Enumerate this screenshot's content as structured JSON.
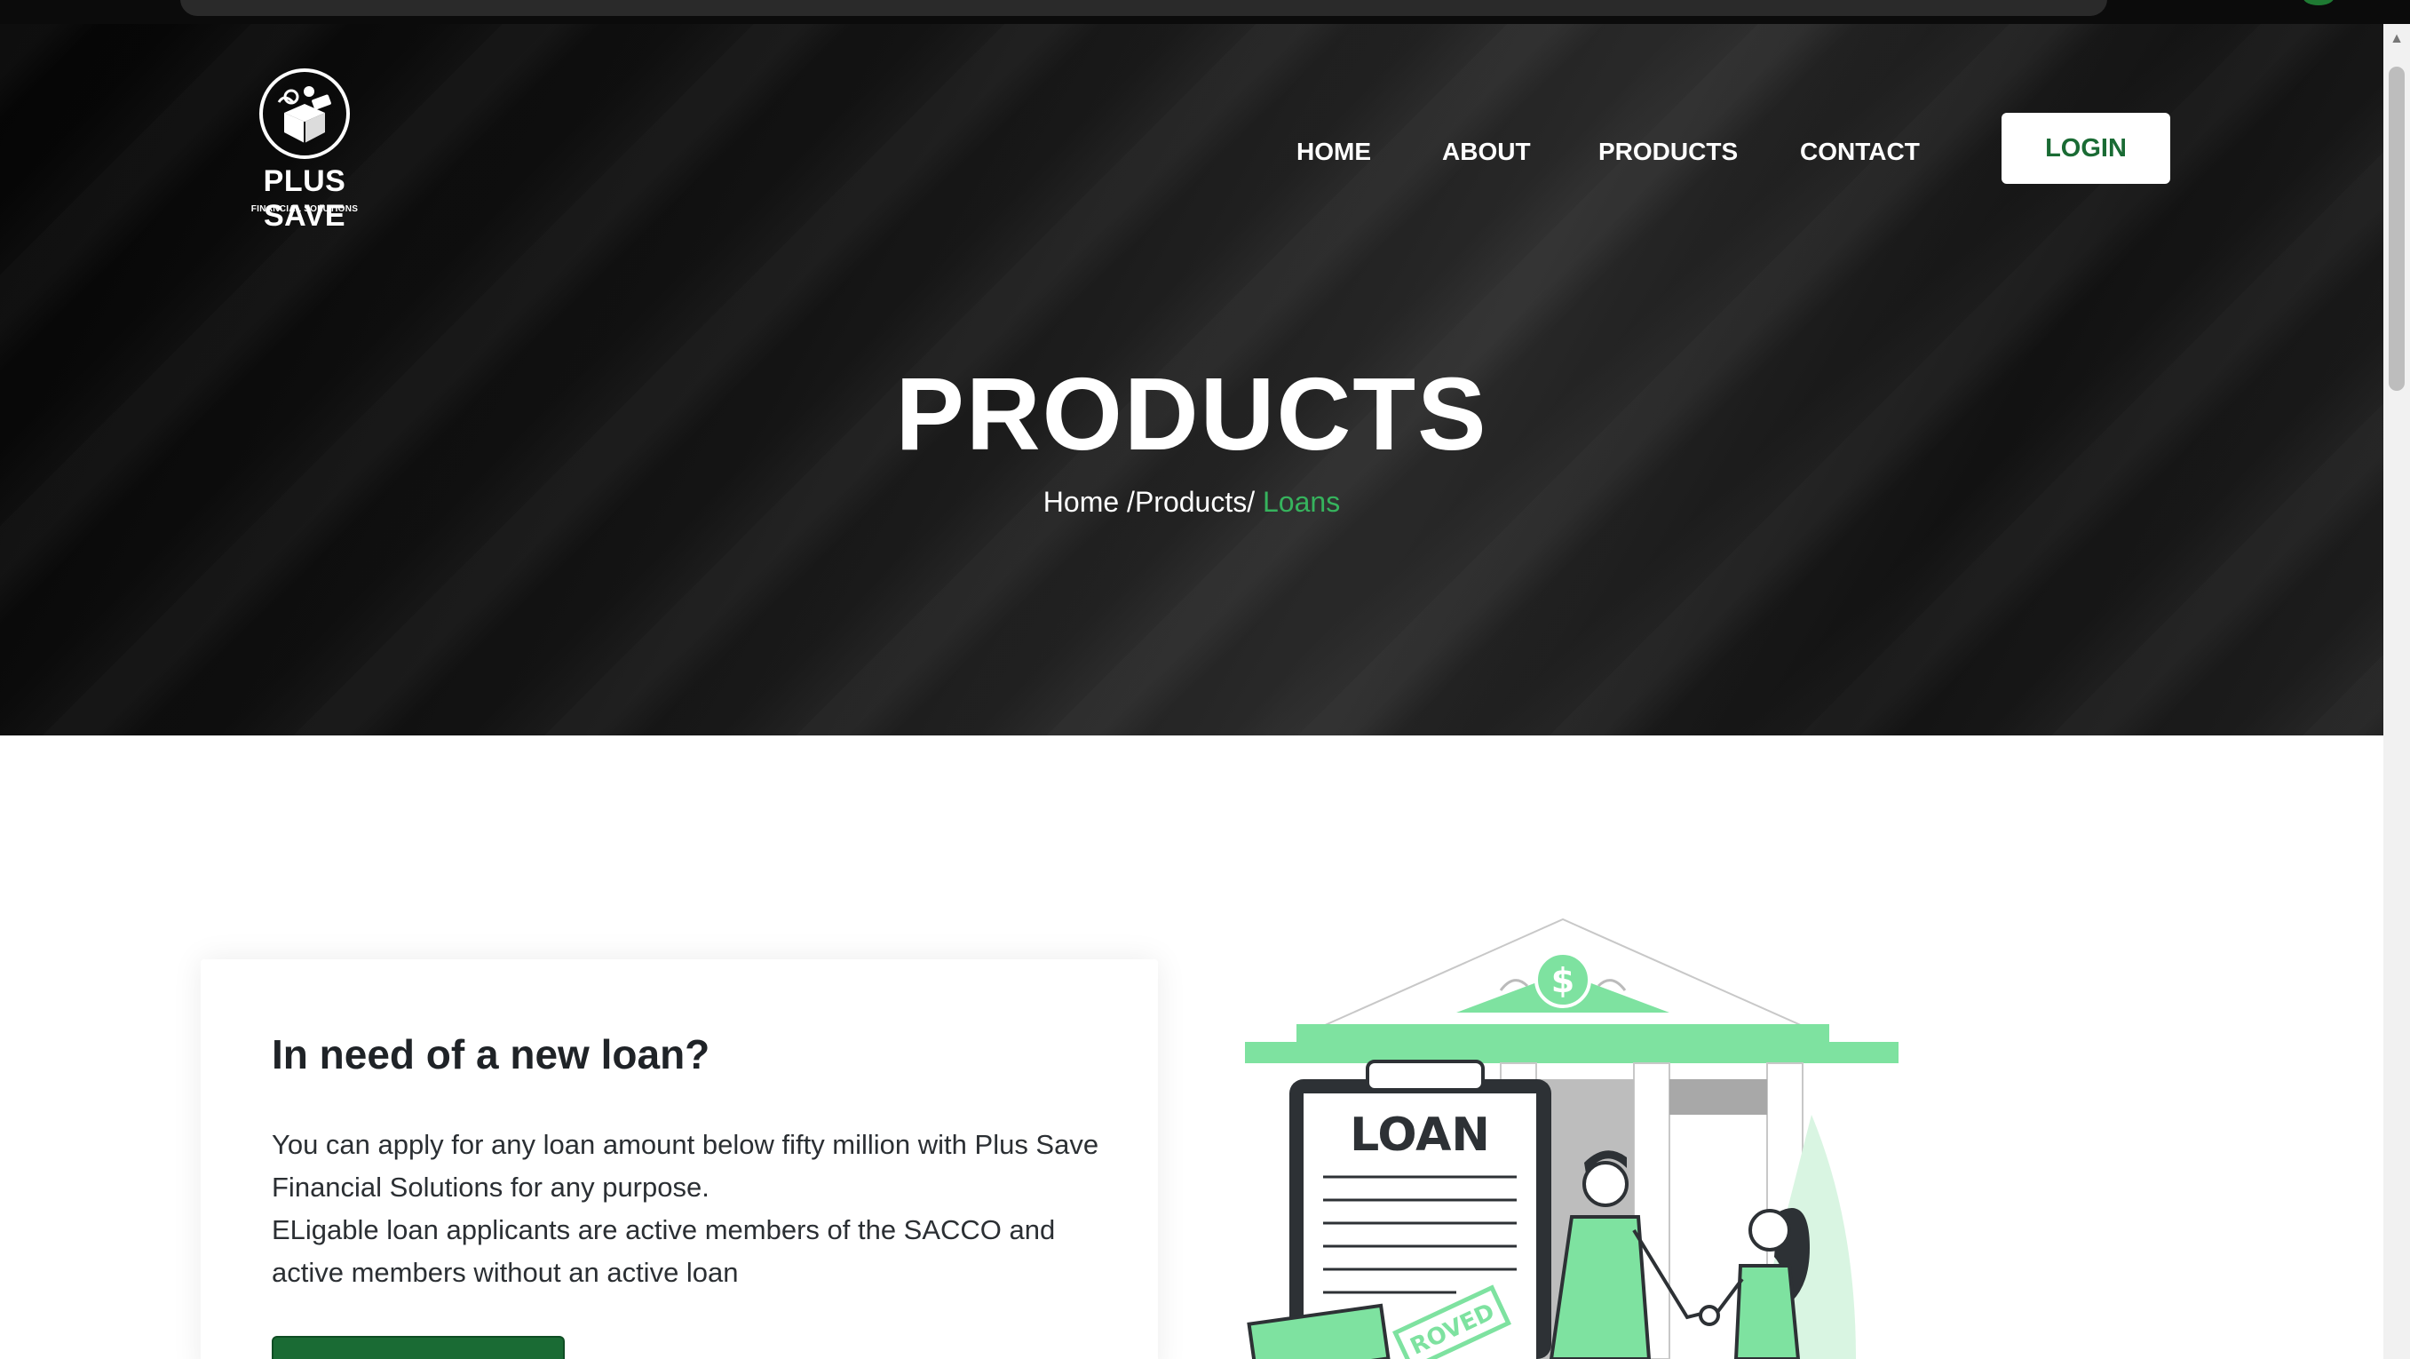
{
  "brand": {
    "name": "PLUS SAVE",
    "tagline": "FINANCIAL SOLUTIONS"
  },
  "nav": {
    "items": [
      {
        "label": "HOME"
      },
      {
        "label": "ABOUT"
      },
      {
        "label": "PRODUCTS"
      },
      {
        "label": "CONTACT"
      }
    ],
    "login_label": "LOGIN"
  },
  "hero": {
    "title": "PRODUCTS",
    "breadcrumb": {
      "home": "Home",
      "sep1": " /",
      "products": "Products",
      "sep2": "/ ",
      "current": "Loans"
    }
  },
  "card": {
    "title": "In need of a new loan?",
    "line1": "You can apply for any loan amount below fifty million with Plus Save Financial Solutions for any purpose.",
    "line2": "ELigable loan applicants are active members of the SACCO and active members without an active loan"
  },
  "illustration": {
    "loan_label": "LOAN",
    "stamp_label": "ROVED"
  },
  "colors": {
    "accent": "#1a6b34",
    "breadcrumb_active": "#36b35d",
    "illustration_green": "#7ee2a0"
  }
}
